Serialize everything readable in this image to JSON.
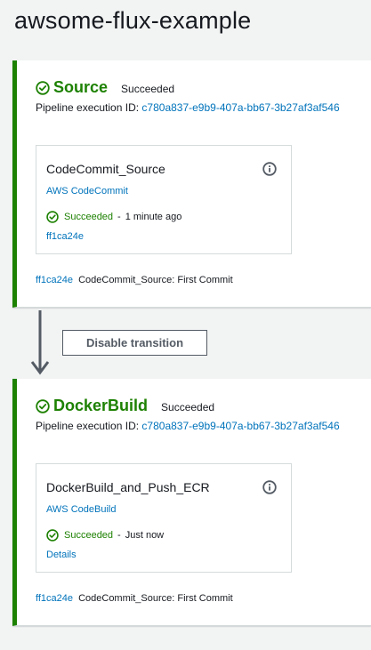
{
  "page": {
    "title": "awsome-flux-example"
  },
  "colors": {
    "success": "#1d8102",
    "link": "#0073bb",
    "text": "#16191f",
    "background": "#f2f3f3",
    "border": "#d5dbdb"
  },
  "stages": [
    {
      "name": "Source",
      "status": "Succeeded",
      "execution_label": "Pipeline execution ID:",
      "execution_id": "c780a837-e9b9-407a-bb67-3b27af3af546",
      "action": {
        "name": "CodeCommit_Source",
        "provider": "AWS CodeCommit",
        "status": "Succeeded",
        "separator": "-",
        "time": "1 minute ago",
        "link": "ff1ca24e"
      },
      "commit": {
        "id": "ff1ca24e",
        "message": "CodeCommit_Source: First Commit"
      }
    },
    {
      "name": "DockerBuild",
      "status": "Succeeded",
      "execution_label": "Pipeline execution ID:",
      "execution_id": "c780a837-e9b9-407a-bb67-3b27af3af546",
      "action": {
        "name": "DockerBuild_and_Push_ECR",
        "provider": "AWS CodeBuild",
        "status": "Succeeded",
        "separator": "-",
        "time": "Just now",
        "link": "Details"
      },
      "commit": {
        "id": "ff1ca24e",
        "message": "CodeCommit_Source: First Commit"
      }
    }
  ],
  "transition": {
    "button_label": "Disable transition"
  },
  "icons": {
    "status": "check-circle-icon",
    "info": "info-icon",
    "transition": "arrow-down-icon"
  }
}
